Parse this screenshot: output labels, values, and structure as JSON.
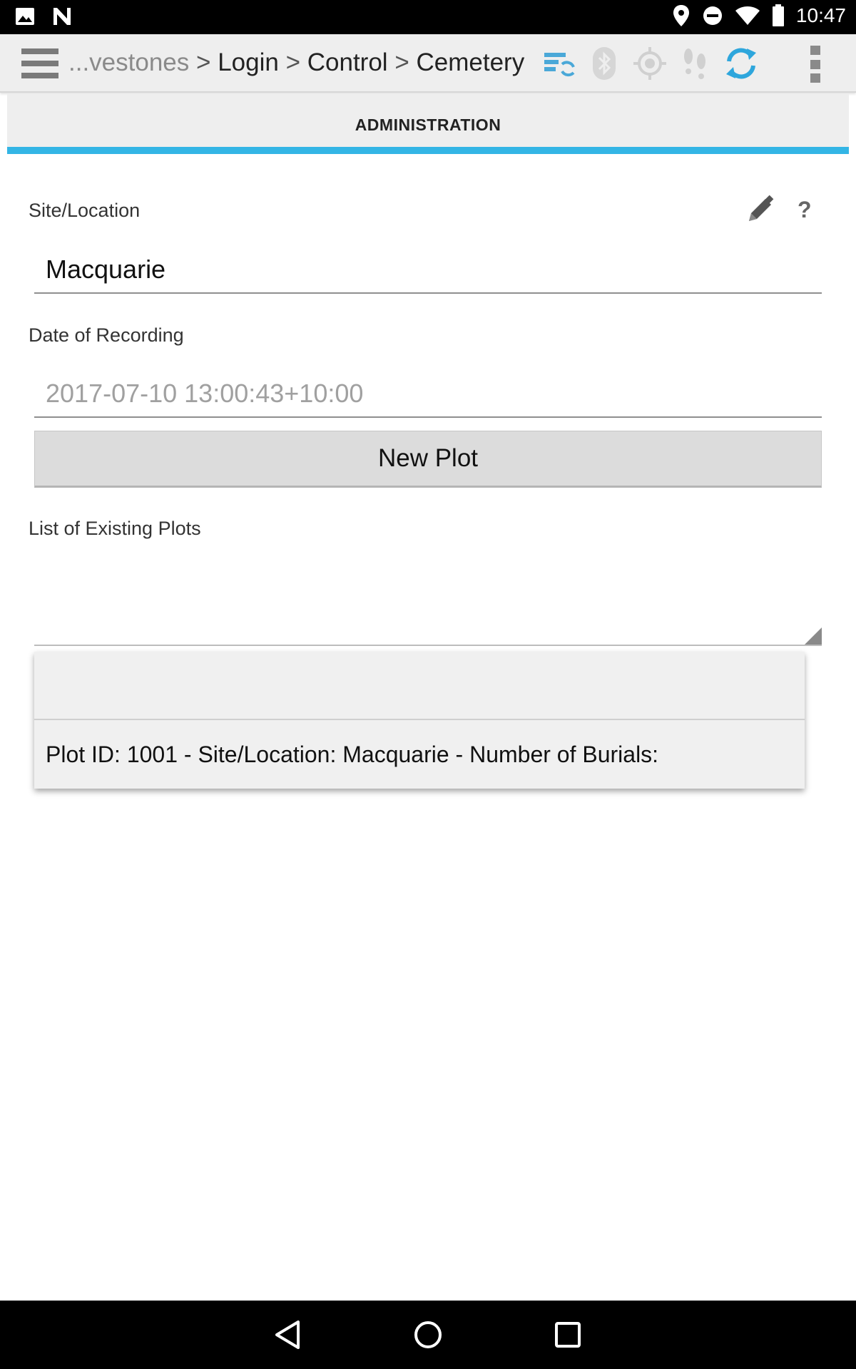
{
  "status_bar": {
    "time": "10:47",
    "left_icons": [
      "image-icon",
      "n-icon"
    ],
    "right_icons": [
      "location-icon",
      "do-not-disturb-icon",
      "wifi-icon",
      "battery-icon"
    ]
  },
  "action_bar": {
    "breadcrumb": {
      "first": "...vestones",
      "separator": ">",
      "second": "Login",
      "third": "Control",
      "fourth": "Cemetery"
    },
    "icons": [
      "sync-list-icon",
      "bluetooth-icon",
      "gps-icon",
      "footsteps-icon",
      "refresh-icon",
      "overflow-menu-icon"
    ],
    "accent_color": "#33b5e5"
  },
  "tab": {
    "label": "ADMINISTRATION",
    "indicator_color": "#33b5e5"
  },
  "form": {
    "site_label": "Site/Location",
    "site_value": "Macquarie",
    "date_label": "Date of Recording",
    "date_hint": "2017-07-10 13:00:43+10:00",
    "new_plot_button": "New Plot",
    "plots_label": "List of Existing Plots"
  },
  "dropdown": {
    "options": [
      "",
      "Plot ID: 1001 - Site/Location: Macquarie - Number of Burials:"
    ]
  }
}
